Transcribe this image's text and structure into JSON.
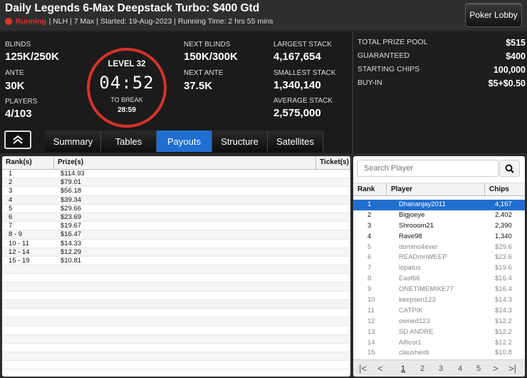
{
  "header": {
    "title": "Daily Legends 6-Max Deepstack Turbo: $400 Gtd",
    "status": "Running",
    "details": "| NLH | 7 Max | Started: 19-Aug-2023 | Running Time: 2 hrs 55 mins",
    "lobby_button": "Poker Lobby"
  },
  "stats": {
    "blinds_label": "Blinds",
    "blinds": "125K/250K",
    "ante_label": "Ante",
    "ante": "30K",
    "players_label": "Players",
    "players": "4/103",
    "level": "LEVEL 32",
    "clock": "04:52",
    "to_break_label": "TO BREAK",
    "to_break": "28:59",
    "next_blinds_label": "Next Blinds",
    "next_blinds": "150K/300K",
    "next_ante_label": "Next Ante",
    "next_ante": "37.5K",
    "largest_label": "Largest Stack",
    "largest": "4,167,654",
    "smallest_label": "Smallest Stack",
    "smallest": "1,340,140",
    "average_label": "Average Stack",
    "average": "2,575,000"
  },
  "prize": {
    "rows": [
      {
        "label": "Total Prize Pool",
        "value": "$515"
      },
      {
        "label": "Guaranteed",
        "value": "$400"
      },
      {
        "label": "Starting Chips",
        "value": "100,000"
      },
      {
        "label": "Buy-In",
        "value": "$5+$0.50"
      }
    ]
  },
  "tabs": [
    "Summary",
    "Tables",
    "Payouts",
    "Structure",
    "Satellites"
  ],
  "active_tab": "Payouts",
  "payouts": {
    "headers": [
      "Rank(s)",
      "Prize(s)",
      "Ticket(s)"
    ],
    "rows": [
      [
        "1",
        "$114.93"
      ],
      [
        "2",
        "$79.01"
      ],
      [
        "3",
        "$56.18"
      ],
      [
        "4",
        "$39.34"
      ],
      [
        "5",
        "$29.66"
      ],
      [
        "6",
        "$23.69"
      ],
      [
        "7",
        "$19.67"
      ],
      [
        "8 - 9",
        "$16.47"
      ],
      [
        "10 - 11",
        "$14.33"
      ],
      [
        "12 - 14",
        "$12.29"
      ],
      [
        "15 - 19",
        "$10.81"
      ]
    ]
  },
  "players": {
    "search_placeholder": "Search Player",
    "headers": [
      "Rank",
      "Player",
      "Chips"
    ],
    "rows": [
      {
        "rank": "1",
        "name": "Dhananjay2011",
        "chips": "4,167",
        "style": "sel"
      },
      {
        "rank": "2",
        "name": "Bigjoeye",
        "chips": "2,402",
        "style": ""
      },
      {
        "rank": "3",
        "name": "Shrooom21",
        "chips": "2,390",
        "style": ""
      },
      {
        "rank": "4",
        "name": "Rave98",
        "chips": "1,340",
        "style": ""
      },
      {
        "rank": "5",
        "name": "domino4ever",
        "chips": "$29.6",
        "style": "grey"
      },
      {
        "rank": "6",
        "name": "READmnWEEP",
        "chips": "$23.6",
        "style": "grey"
      },
      {
        "rank": "7",
        "name": "lopatus",
        "chips": "$19.6",
        "style": "grey"
      },
      {
        "rank": "8",
        "name": "East66",
        "chips": "$16.4",
        "style": "grey"
      },
      {
        "rank": "9",
        "name": "ONETIMEMIKE77",
        "chips": "$16.4",
        "style": "grey"
      },
      {
        "rank": "10",
        "name": "keepsen123",
        "chips": "$14.3",
        "style": "grey"
      },
      {
        "rank": "11",
        "name": "CATPIK",
        "chips": "$14.3",
        "style": "grey"
      },
      {
        "rank": "12",
        "name": "owned123",
        "chips": "$12.2",
        "style": "grey"
      },
      {
        "rank": "13",
        "name": "SD ANDRE",
        "chips": "$12.2",
        "style": "grey"
      },
      {
        "rank": "14",
        "name": "Alficor1",
        "chips": "$12.2",
        "style": "grey"
      },
      {
        "rank": "15",
        "name": "clausheidi",
        "chips": "$10.8",
        "style": "grey"
      }
    ],
    "pages": [
      "1",
      "2",
      "3",
      "4",
      "5"
    ],
    "current_page": "1"
  },
  "colors": {
    "accent": "#1f6fd1",
    "running": "#e0302a",
    "clock_ring": "#d2332b"
  }
}
